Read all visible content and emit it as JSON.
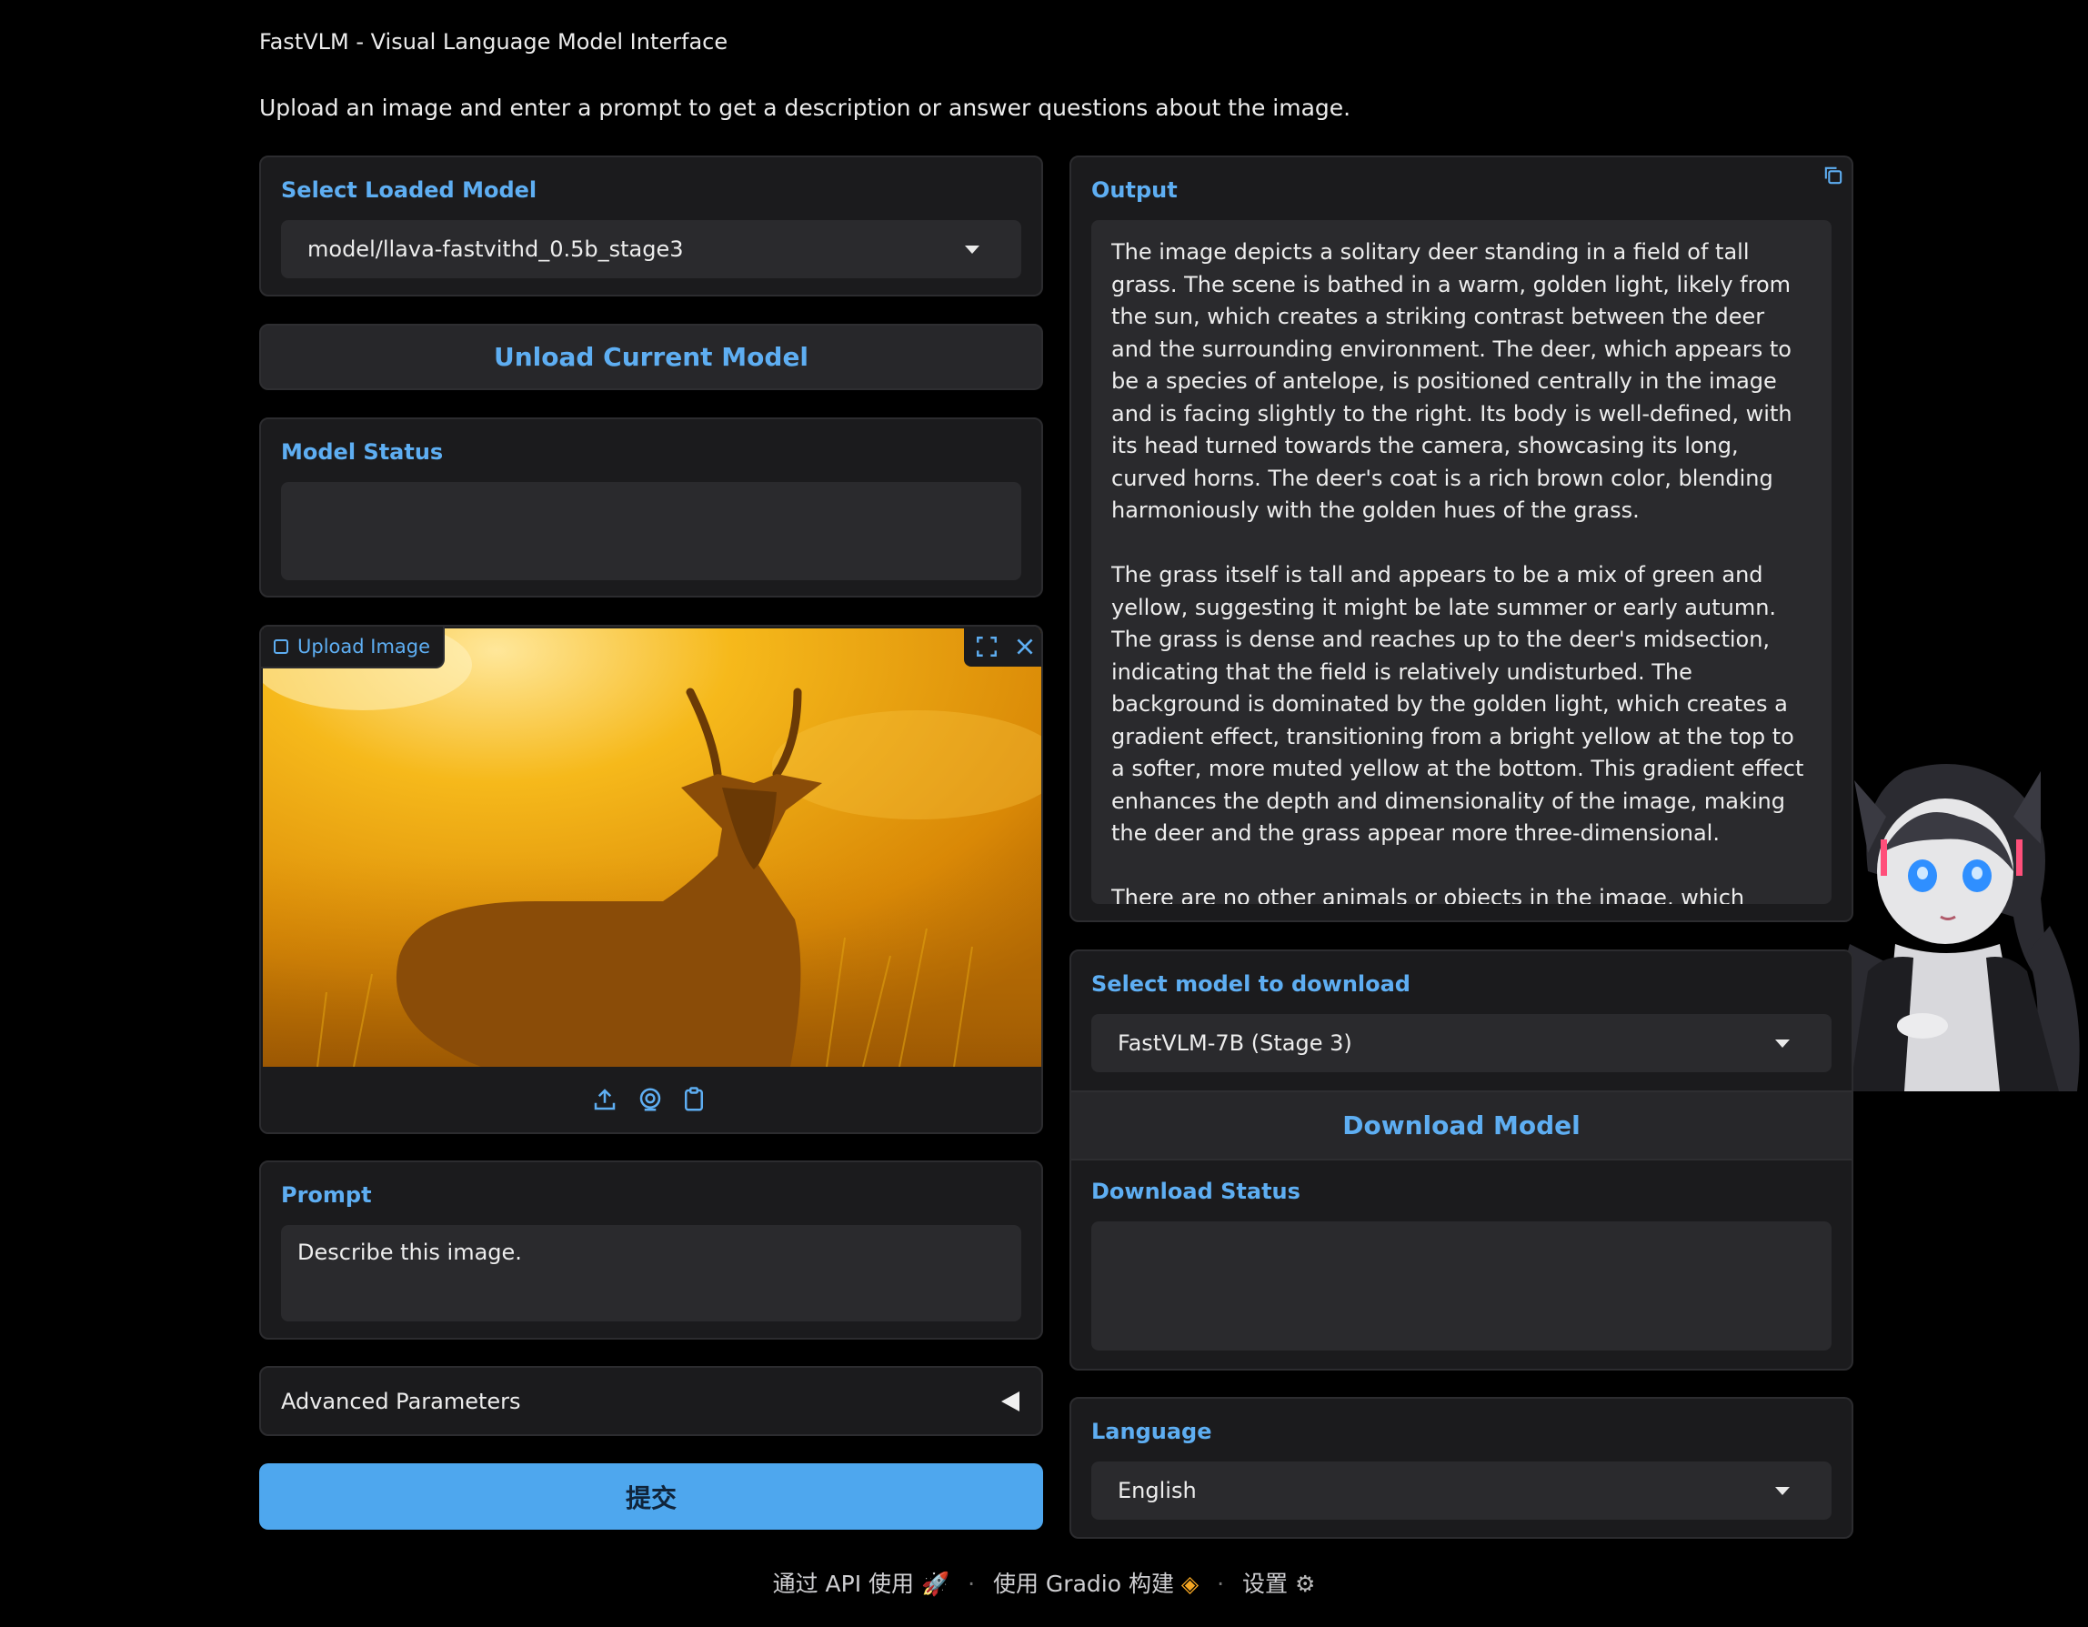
{
  "app": {
    "title": "FastVLM - Visual Language Model Interface",
    "description": "Upload an image and enter a prompt to get a description or answer questions about the image."
  },
  "left": {
    "model_select": {
      "label": "Select Loaded Model",
      "value": "model/llava-fastvithd_0.5b_stage3"
    },
    "unload_button": "Unload Current Model",
    "model_status": {
      "label": "Model Status",
      "value": ""
    },
    "image_upload": {
      "label": "Upload Image",
      "icons": [
        "fullscreen-icon",
        "close-icon",
        "upload-icon",
        "webcam-icon",
        "clipboard-icon"
      ]
    },
    "prompt": {
      "label": "Prompt",
      "value": "Describe this image."
    },
    "advanced": {
      "label": "Advanced Parameters"
    },
    "submit_button": "提交"
  },
  "right": {
    "output": {
      "label": "Output",
      "text": "The image depicts a solitary deer standing in a field of tall grass. The scene is bathed in a warm, golden light, likely from the sun, which creates a striking contrast between the deer and the surrounding environment. The deer, which appears to be a species of antelope, is positioned centrally in the image and is facing slightly to the right. Its body is well-defined, with its head turned towards the camera, showcasing its long, curved horns. The deer's coat is a rich brown color, blending harmoniously with the golden hues of the grass.\n\nThe grass itself is tall and appears to be a mix of green and yellow, suggesting it might be late summer or early autumn. The grass is dense and reaches up to the deer's midsection, indicating that the field is relatively undisturbed. The background is dominated by the golden light, which creates a gradient effect, transitioning from a bright yellow at the top to a softer, more muted yellow at the bottom. This gradient effect enhances the depth and dimensionality of the image, making the deer and the grass appear more three-dimensional.\n\nThere are no other animals or objects in the image, which places the focus entirely on the deer and the natural environment. The absence"
    },
    "download_select": {
      "label": "Select model to download",
      "value": "FastVLM-7B (Stage 3)"
    },
    "download_button": "Download Model",
    "download_status": {
      "label": "Download Status",
      "value": ""
    },
    "language": {
      "label": "Language",
      "value": "English"
    }
  },
  "footer": {
    "api": "通过 API 使用",
    "built": "使用 Gradio 构建",
    "settings": "设置",
    "separator": "·"
  },
  "colors": {
    "accent": "#5eaef2",
    "primary_button": "#4ea7ee",
    "panel": "#1b1b1d",
    "background": "#000000"
  }
}
